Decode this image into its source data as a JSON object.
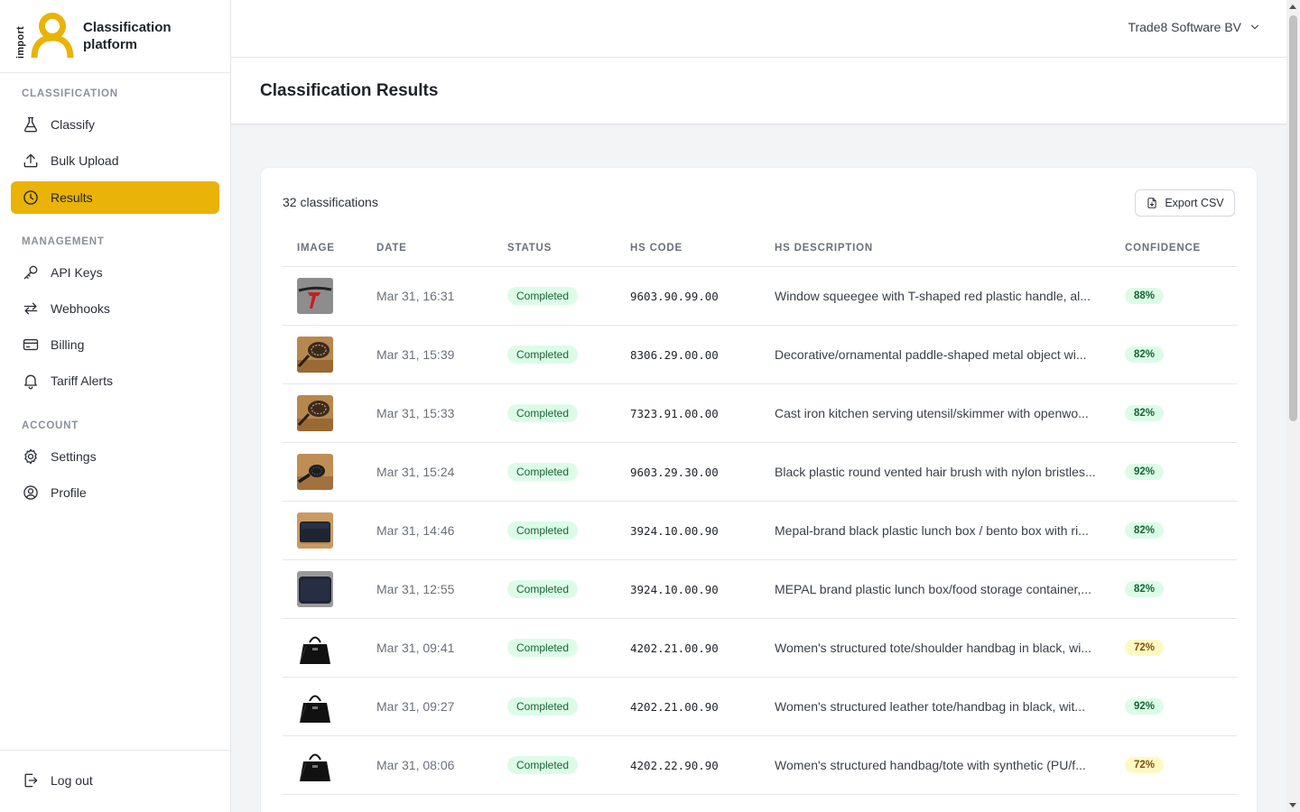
{
  "brand": {
    "logo_text": "import",
    "name_line1": "Classification",
    "name_line2": "platform",
    "accent": "#e9b308"
  },
  "sidebar": {
    "sections": [
      {
        "title": "CLASSIFICATION",
        "items": [
          {
            "label": "Classify",
            "icon": "flask-icon"
          },
          {
            "label": "Bulk Upload",
            "icon": "upload-icon"
          },
          {
            "label": "Results",
            "icon": "clock-icon",
            "active": true
          }
        ]
      },
      {
        "title": "MANAGEMENT",
        "items": [
          {
            "label": "API Keys",
            "icon": "key-icon"
          },
          {
            "label": "Webhooks",
            "icon": "arrows-exchange-icon"
          },
          {
            "label": "Billing",
            "icon": "credit-card-icon"
          },
          {
            "label": "Tariff Alerts",
            "icon": "bell-icon"
          }
        ]
      },
      {
        "title": "ACCOUNT",
        "items": [
          {
            "label": "Settings",
            "icon": "gear-icon"
          },
          {
            "label": "Profile",
            "icon": "user-circle-icon"
          }
        ]
      }
    ],
    "logout_label": "Log out"
  },
  "header": {
    "org_name": "Trade8 Software BV"
  },
  "page": {
    "title": "Classification Results"
  },
  "results": {
    "count_label": "32 classifications",
    "export_label": "Export CSV",
    "columns": [
      "IMAGE",
      "DATE",
      "STATUS",
      "HS CODE",
      "HS DESCRIPTION",
      "CONFIDENCE"
    ],
    "rows": [
      {
        "thumb": "squeegee",
        "date": "Mar 31, 16:31",
        "status": "Completed",
        "hs_code": "9603.90.99.00",
        "description": "Window squeegee with T-shaped red plastic handle, al...",
        "confidence": "88%",
        "level": "high"
      },
      {
        "thumb": "paddle",
        "date": "Mar 31, 15:39",
        "status": "Completed",
        "hs_code": "8306.29.00.00",
        "description": "Decorative/ornamental paddle-shaped metal object wi...",
        "confidence": "82%",
        "level": "high"
      },
      {
        "thumb": "paddle",
        "date": "Mar 31, 15:33",
        "status": "Completed",
        "hs_code": "7323.91.00.00",
        "description": "Cast iron kitchen serving utensil/skimmer with openwo...",
        "confidence": "82%",
        "level": "high"
      },
      {
        "thumb": "brush",
        "date": "Mar 31, 15:24",
        "status": "Completed",
        "hs_code": "9603.29.30.00",
        "description": "Black plastic round vented hair brush with nylon bristles...",
        "confidence": "92%",
        "level": "high"
      },
      {
        "thumb": "lunchbox-light",
        "date": "Mar 31, 14:46",
        "status": "Completed",
        "hs_code": "3924.10.00.90",
        "description": "Mepal-brand black plastic lunch box / bento box with ri...",
        "confidence": "82%",
        "level": "high"
      },
      {
        "thumb": "lunchbox-dark",
        "date": "Mar 31, 12:55",
        "status": "Completed",
        "hs_code": "3924.10.00.90",
        "description": "MEPAL brand plastic lunch box/food storage container,...",
        "confidence": "82%",
        "level": "high"
      },
      {
        "thumb": "handbag",
        "date": "Mar 31, 09:41",
        "status": "Completed",
        "hs_code": "4202.21.00.90",
        "description": "Women's structured tote/shoulder handbag in black, wi...",
        "confidence": "72%",
        "level": "mid"
      },
      {
        "thumb": "handbag",
        "date": "Mar 31, 09:27",
        "status": "Completed",
        "hs_code": "4202.21.00.90",
        "description": "Women's structured leather tote/handbag in black, wit...",
        "confidence": "92%",
        "level": "high"
      },
      {
        "thumb": "handbag",
        "date": "Mar 31, 08:06",
        "status": "Completed",
        "hs_code": "4202.22.90.90",
        "description": "Women's structured handbag/tote with synthetic (PU/f...",
        "confidence": "72%",
        "level": "mid"
      }
    ]
  }
}
